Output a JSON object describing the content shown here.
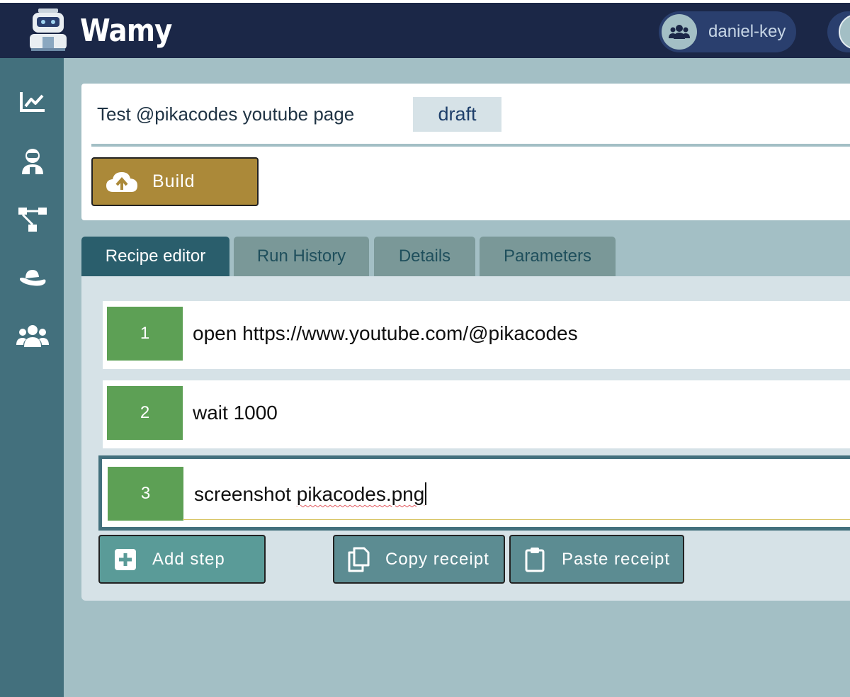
{
  "app": {
    "title": "Wamy",
    "user_name": "daniel-key"
  },
  "sidebar": {
    "items": [
      {
        "icon": "chart-line-icon"
      },
      {
        "icon": "robot-icon"
      },
      {
        "icon": "sitemap-icon"
      },
      {
        "icon": "hat-icon"
      },
      {
        "icon": "users-icon"
      }
    ]
  },
  "recipe": {
    "title": "Test @pikacodes youtube page",
    "status": "draft",
    "build_label": "Build"
  },
  "tabs": [
    {
      "label": "Recipe editor",
      "active": true
    },
    {
      "label": "Run History",
      "active": false
    },
    {
      "label": "Details",
      "active": false
    },
    {
      "label": "Parameters",
      "active": false
    }
  ],
  "steps": [
    {
      "number": "1",
      "command": "open https://www.youtube.com/@pikacodes"
    },
    {
      "number": "2",
      "command": "wait 1000"
    },
    {
      "number": "3",
      "command_prefix": "screenshot ",
      "command_suffix": "pikacodes.png"
    }
  ],
  "actions": {
    "add_step": "Add step",
    "copy_receipt": "Copy receipt",
    "paste_receipt": "Paste receipt"
  },
  "colors": {
    "topbar": "#1b2747",
    "sidebar": "#43707d",
    "background": "#a3bfc5",
    "build_button": "#ab8939",
    "step_number": "#5da055",
    "active_tab": "#2a5e6c"
  }
}
